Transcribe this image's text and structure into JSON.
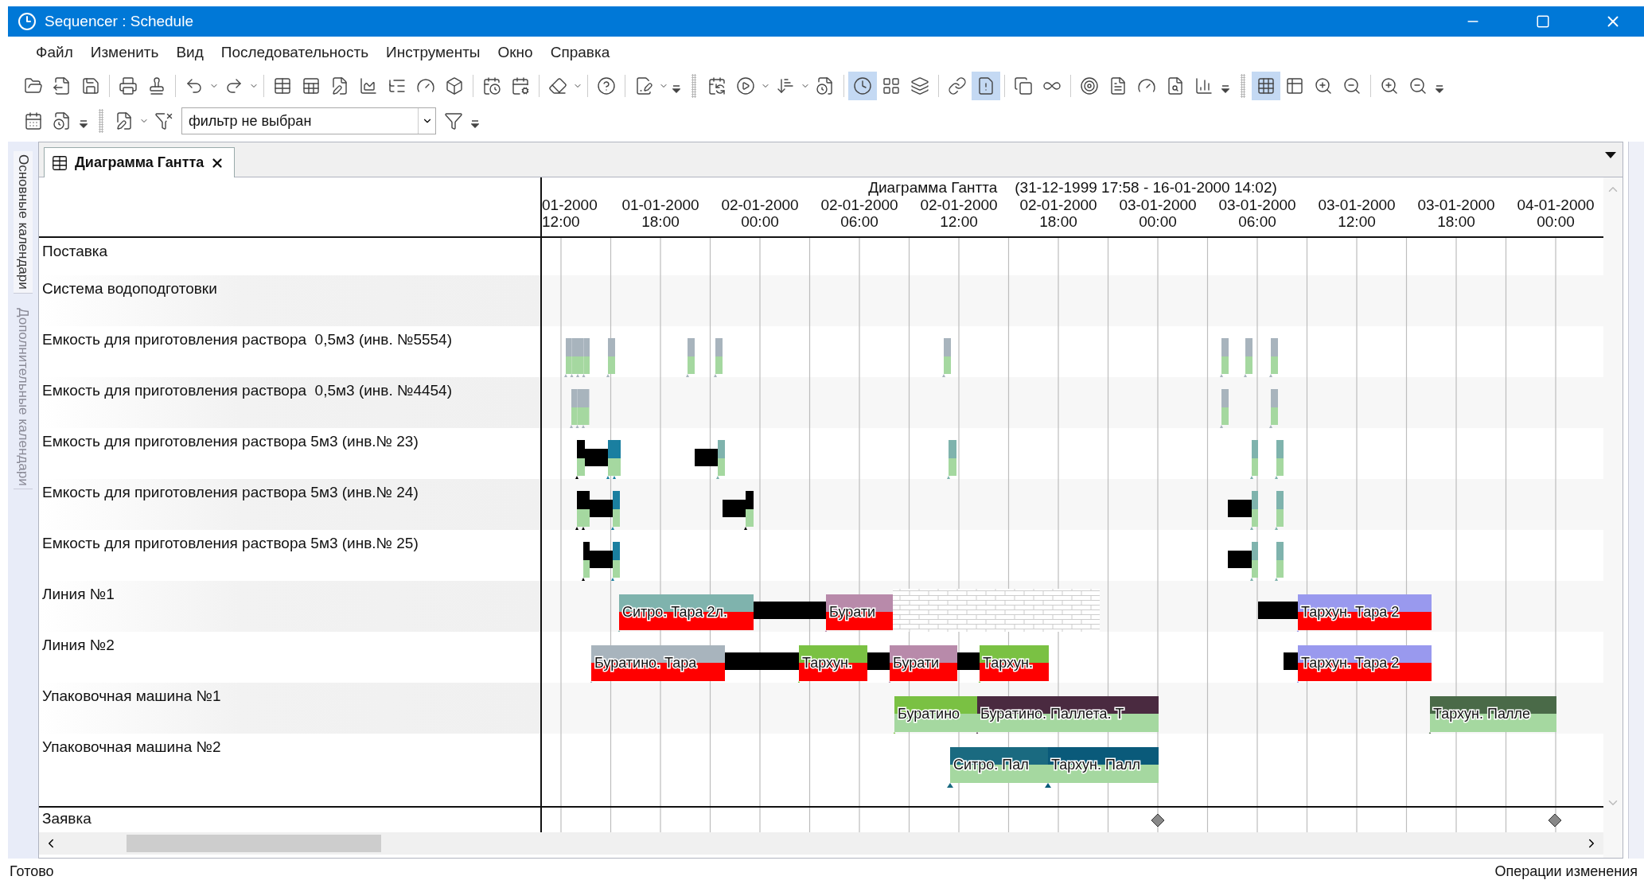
{
  "window": {
    "title": "Sequencer : Schedule"
  },
  "menu": [
    "Файл",
    "Изменить",
    "Вид",
    "Последовательность",
    "Инструменты",
    "Окно",
    "Справка"
  ],
  "toolbar": [
    {
      "pressed": false
    },
    {
      "pressed": false
    },
    {
      "pressed": false
    },
    {
      "pressed": false
    },
    {
      "pressed": false
    },
    {
      "pressed": false
    },
    {
      "pressed": false
    },
    {
      "pressed": false
    },
    {
      "pressed": false
    },
    {
      "pressed": false
    },
    {
      "pressed": false
    },
    {
      "pressed": false
    },
    {
      "pressed": false
    },
    {
      "pressed": false
    },
    {
      "pressed": false
    },
    {
      "pressed": false
    },
    {
      "pressed": false
    },
    {
      "pressed": false
    },
    {
      "pressed": false
    },
    {
      "pressed": false
    },
    {
      "pressed": false
    },
    {
      "pressed": false
    },
    {
      "pressed": false
    },
    {
      "pressed": true
    },
    {
      "pressed": false
    },
    {
      "pressed": false
    },
    {
      "pressed": false
    },
    {
      "pressed": true
    },
    {
      "pressed": false
    },
    {
      "pressed": false
    },
    {
      "pressed": false
    },
    {
      "pressed": false
    },
    {
      "pressed": false
    },
    {
      "pressed": false
    },
    {
      "pressed": false
    },
    {
      "pressed": true
    },
    {
      "pressed": false
    },
    {
      "pressed": false
    },
    {
      "pressed": false
    },
    {
      "pressed": false
    },
    {
      "pressed": false
    }
  ],
  "filter": {
    "value": "фильтр не выбран"
  },
  "side_tabs": [
    {
      "label": "Основные календари",
      "selected": true
    },
    {
      "label": "Дополнительные календари",
      "selected": false
    }
  ],
  "document_tab": {
    "label": "Диаграмма Гантта"
  },
  "gantt": {
    "title": "Диаграмма Гантта",
    "period": "(31-12-1999 17:58 - 16-01-2000 14:02)",
    "time_scale": [
      {
        "date": "01-2000",
        "time": "12:00"
      },
      {
        "date": "01-01-2000",
        "time": "18:00"
      },
      {
        "date": "02-01-2000",
        "time": "00:00"
      },
      {
        "date": "02-01-2000",
        "time": "06:00"
      },
      {
        "date": "02-01-2000",
        "time": "12:00"
      },
      {
        "date": "02-01-2000",
        "time": "18:00"
      },
      {
        "date": "03-01-2000",
        "time": "00:00"
      },
      {
        "date": "03-01-2000",
        "time": "06:00"
      },
      {
        "date": "03-01-2000",
        "time": "12:00"
      },
      {
        "date": "03-01-2000",
        "time": "18:00"
      },
      {
        "date": "04-01-2000",
        "time": "00:00"
      }
    ],
    "group": "Поставка",
    "resources": [
      {
        "name": "Система водоподготовки"
      },
      {
        "name": "Емкость для приготовления раствора  0,5м3 (инв. №5554)"
      },
      {
        "name": "Емкость для приготовления раствора  0,5м3 (инв. №4454)"
      },
      {
        "name": "Емкость для приготовления раствора 5м3 (инв.№ 23)"
      },
      {
        "name": "Емкость для приготовления раствора 5м3 (инв.№ 24)"
      },
      {
        "name": "Емкость для приготовления раствора 5м3 (инв.№ 25)"
      },
      {
        "name": "Линия №1",
        "operations": [
          {
            "label": "Ситро. Тара 2л.",
            "color": "#7fb3ad"
          },
          {
            "label": "Бурати",
            "color": "#b88aaa"
          },
          {
            "label": "Тархун. Тара 2",
            "color": "#9999ee"
          }
        ]
      },
      {
        "name": "Линия №2",
        "operations": [
          {
            "label": "Буратино. Тара",
            "color": "#a8b4bd"
          },
          {
            "label": "Тархун.",
            "color": "#7ac143"
          },
          {
            "label": "Бурати",
            "color": "#b88aaa"
          },
          {
            "label": "Тархун.",
            "color": "#7ac143"
          },
          {
            "label": "Тархун. Тара 2",
            "color": "#9999ee"
          }
        ]
      },
      {
        "name": "Упаковочная машина №1",
        "operations": [
          {
            "label": "Буратино",
            "color": "#7ac143"
          },
          {
            "label": "Буратино. Паллета. Т",
            "color": "#4a2a40"
          },
          {
            "label": "Тархун. Палле",
            "color": "#4a6a48"
          }
        ]
      },
      {
        "name": "Упаковочная машина №2",
        "operations": [
          {
            "label": "Ситро. Пал",
            "color": "#1a6a80"
          },
          {
            "label": "Тархун. Палл",
            "color": "#0a5a7a"
          }
        ]
      }
    ],
    "footer_row": "Заявка"
  },
  "status_bar": {
    "left": "Готово",
    "right": "Операции изменения"
  }
}
